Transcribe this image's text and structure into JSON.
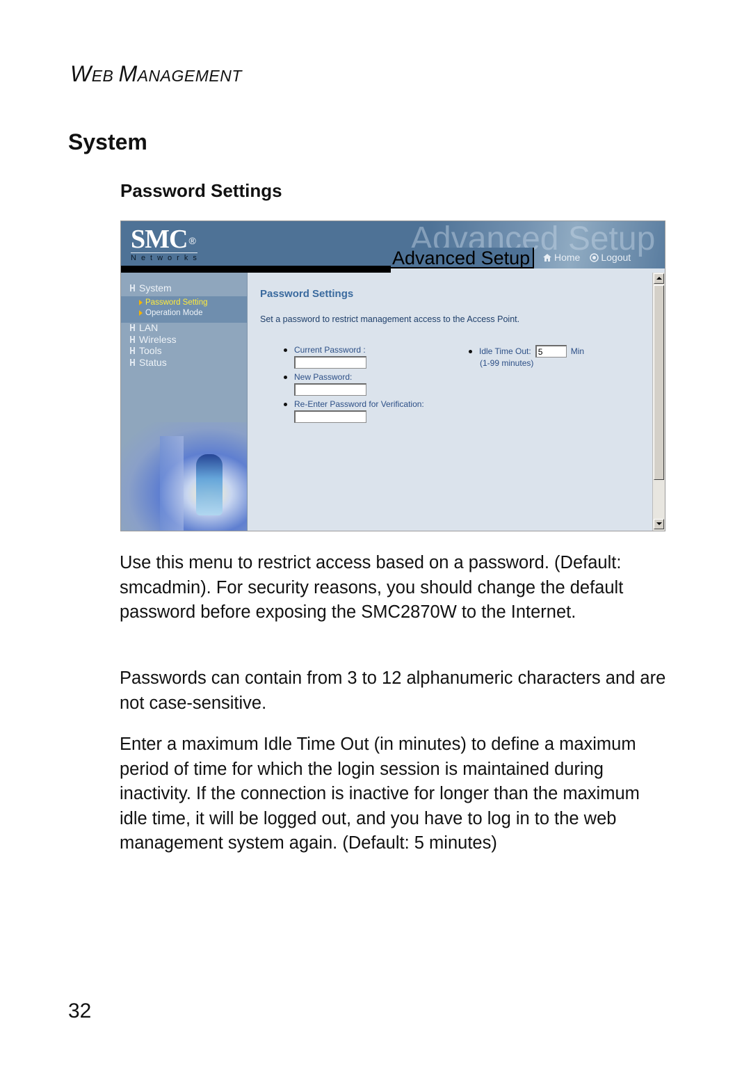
{
  "page": {
    "running_head": {
      "first_big": "W",
      "first_rest": "EB",
      "second_big": "M",
      "second_rest": "ANAGEMENT"
    },
    "section_title": "System",
    "subsection_title": "Password Settings",
    "page_number": "32"
  },
  "screenshot": {
    "logo": {
      "brand": "SMC",
      "registered": "®",
      "subtitle": "Networks"
    },
    "banner_watermark": "Advanced Setup",
    "banner_title": "Advanced Setup",
    "nav": [
      {
        "label": "Home",
        "icon": "home-icon"
      },
      {
        "label": "Logout",
        "icon": "logout-icon"
      }
    ],
    "sidebar": {
      "items": [
        {
          "label": "System",
          "expanded": true,
          "children": [
            {
              "label": "Password Setting",
              "active": true
            },
            {
              "label": "Operation Mode",
              "active": false
            }
          ]
        },
        {
          "label": "LAN"
        },
        {
          "label": "Wireless"
        },
        {
          "label": "Tools"
        },
        {
          "label": "Status"
        }
      ]
    },
    "content": {
      "title": "Password Settings",
      "description": "Set a password to restrict management access to the Access Point.",
      "fields": [
        {
          "label": "Current Password :",
          "value": ""
        },
        {
          "label": "New Password:",
          "value": ""
        },
        {
          "label": "Re-Enter Password for Verification:",
          "value": ""
        }
      ],
      "idle_timeout": {
        "label": "Idle Time Out:",
        "value": "5",
        "unit": "Min",
        "hint": "(1-99 minutes)"
      }
    },
    "colors": {
      "banner": "#4e7296",
      "sidebar": "#8fa6bd",
      "content_bg": "#dbe3ec",
      "title": "#3a6a9e",
      "active_item": "#ffeb3b"
    }
  },
  "body": {
    "paragraphs": [
      "Use this menu to restrict access based on a password. (Default: smcadmin). For security reasons, you should change the default password before exposing the SMC2870W to the Internet.",
      "Passwords can contain from 3 to 12 alphanumeric characters and are not case-sensitive.",
      "Enter a maximum Idle Time Out (in minutes) to define a maximum period of time for which the login session is maintained during inactivity. If the connection is inactive for longer than the maximum idle time, it will be logged out, and you have to log in to the web management system again. (Default: 5 minutes)"
    ]
  }
}
